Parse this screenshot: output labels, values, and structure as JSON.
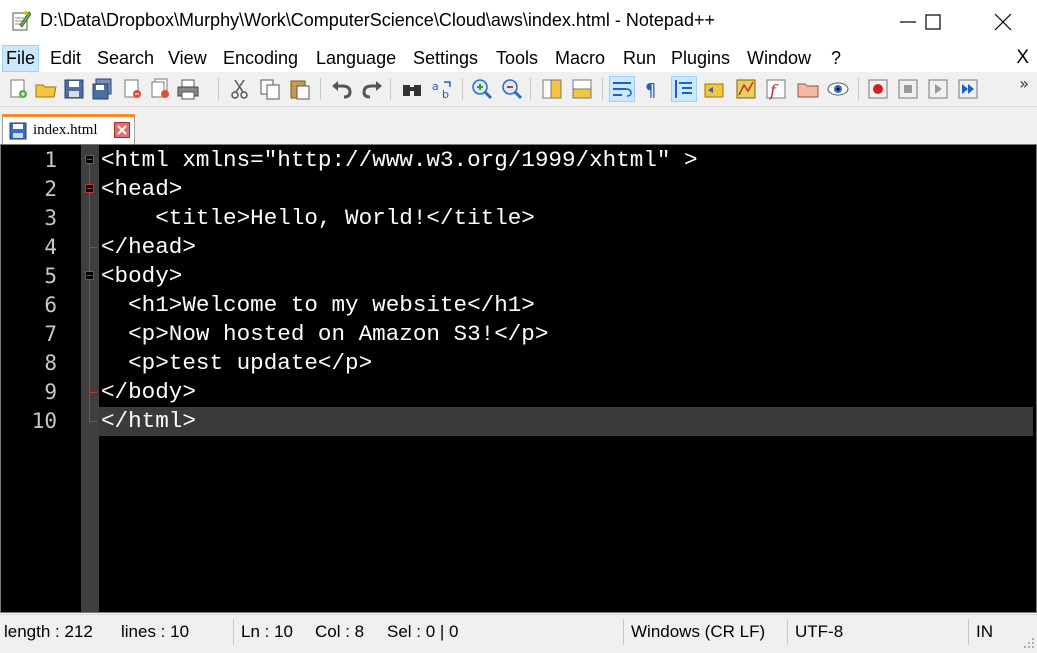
{
  "window": {
    "title": "D:\\Data\\Dropbox\\Murphy\\Work\\ComputerScience\\Cloud\\aws\\index.html - Notepad++"
  },
  "menu": {
    "items": [
      "File",
      "Edit",
      "Search",
      "View",
      "Encoding",
      "Language",
      "Settings",
      "Tools",
      "Macro",
      "Run",
      "Plugins",
      "Window",
      "?"
    ],
    "close": "X"
  },
  "toolbar": {
    "buttons": [
      "new-file-icon",
      "open-file-icon",
      "save-icon",
      "save-all-icon",
      "close-icon",
      "close-all-icon",
      "print-icon",
      "cut-icon",
      "copy-icon",
      "paste-icon",
      "undo-icon",
      "redo-icon",
      "find-icon",
      "replace-icon",
      "zoom-in-icon",
      "zoom-out-icon",
      "sync-vertical-icon",
      "sync-horizontal-icon",
      "word-wrap-icon",
      "show-all-chars-icon",
      "indent-guide-icon",
      "udl-icon",
      "document-map-icon",
      "function-list-icon",
      "folder-workspace-icon",
      "monitoring-icon",
      "record-macro-icon",
      "stop-record-icon",
      "playback-icon",
      "run-macro-multiple-icon"
    ],
    "more": "»"
  },
  "tab": {
    "label": "index.html"
  },
  "editor": {
    "line_numbers": [
      "1",
      "2",
      "3",
      "4",
      "5",
      "6",
      "7",
      "8",
      "9",
      "10"
    ],
    "lines": [
      "<html xmlns=\"http://www.w3.org/1999/xhtml\" >",
      "<head>",
      "    <title>Hello, World!</title>",
      "</head>",
      "<body>",
      "  <h1>Welcome to my website</h1>",
      "  <p>Now hosted on Amazon S3!</p>",
      "  <p>test update</p>",
      "</body>",
      "</html>"
    ],
    "current_line": 10
  },
  "status": {
    "length": "length : 212",
    "lines": "lines : 10",
    "ln": "Ln : 10",
    "col": "Col : 8",
    "sel": "Sel : 0 | 0",
    "eol": "Windows (CR LF)",
    "encoding": "UTF-8",
    "mode": "IN"
  },
  "colors": {
    "editor_bg": "#000000",
    "fold_marker": "#d23030",
    "tab_accent": "#fa8c28",
    "caret_line": "#3a3a3a"
  }
}
